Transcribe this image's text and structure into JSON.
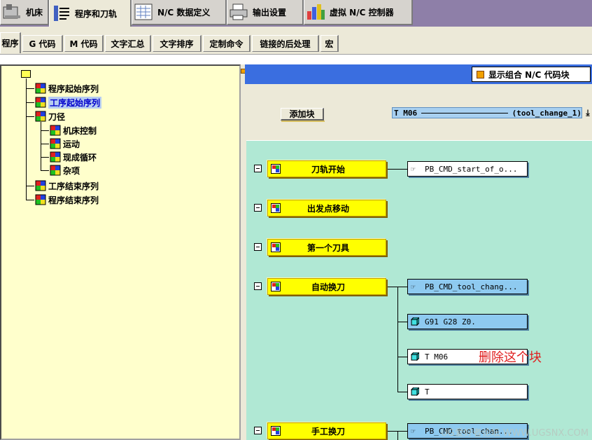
{
  "top_tabs": [
    {
      "label": "机床",
      "icon": "machine-tool-icon",
      "active": false
    },
    {
      "label": "程序和刀轨",
      "icon": "program-toolpath-icon",
      "active": true
    },
    {
      "label": "N/C 数据定义",
      "icon": "nc-data-icon",
      "active": false
    },
    {
      "label": "输出设置",
      "icon": "printer-icon",
      "active": false
    },
    {
      "label": "虚拟 N/C 控制器",
      "icon": "virtual-controller-icon",
      "active": false
    }
  ],
  "sub_tabs": [
    {
      "label": "程序",
      "active": true
    },
    {
      "label": "G 代码",
      "active": false
    },
    {
      "label": "M 代码",
      "active": false
    },
    {
      "label": "文字汇总",
      "active": false
    },
    {
      "label": "文字排序",
      "active": false
    },
    {
      "label": "定制命令",
      "active": false
    },
    {
      "label": "链接的后处理",
      "active": false
    },
    {
      "label": "宏",
      "active": false
    }
  ],
  "tree": {
    "root_icon": "folder-icon",
    "items": [
      {
        "label": "程序起始序列",
        "level": 1,
        "selected": false
      },
      {
        "label": "工序起始序列",
        "level": 1,
        "selected": true
      },
      {
        "label": "刀径",
        "level": 1,
        "selected": false
      },
      {
        "label": "机床控制",
        "level": 2,
        "selected": false
      },
      {
        "label": "运动",
        "level": 2,
        "selected": false
      },
      {
        "label": "现成循环",
        "level": 2,
        "selected": false
      },
      {
        "label": "杂项",
        "level": 2,
        "selected": false
      },
      {
        "label": "工序结束序列",
        "level": 1,
        "selected": false
      },
      {
        "label": "程序结束序列",
        "level": 1,
        "selected": false
      }
    ]
  },
  "right_panel": {
    "show_combined_label": "显示组合 N/C 代码块",
    "add_block_label": "添加块",
    "block_select": {
      "left": "T M06",
      "right": "(tool_change_1)"
    }
  },
  "events": [
    {
      "label": "刀轨开始",
      "blocks": [
        {
          "text": "PB_CMD_start_of_o...",
          "type": "command",
          "highlight": false
        }
      ]
    },
    {
      "label": "出发点移动",
      "blocks": []
    },
    {
      "label": "第一个刀具",
      "blocks": []
    },
    {
      "label": "自动换刀",
      "blocks": [
        {
          "text": "PB_CMD_tool_chang...",
          "type": "command",
          "highlight": true
        },
        {
          "text": "G91 G28 Z0.",
          "type": "block",
          "highlight": true
        },
        {
          "text": "T M06",
          "type": "block",
          "highlight": false
        },
        {
          "text": "T",
          "type": "block",
          "highlight": false
        }
      ]
    },
    {
      "label": "手工换刀",
      "blocks": [
        {
          "text": "PB_CMD_tool_chan...",
          "type": "command",
          "highlight": true
        }
      ]
    }
  ],
  "annotation": "删除这个块",
  "watermark": "UG爱好者论坛 WWW.UGSNX.COM",
  "colors": {
    "top_bar": "#8e7fa8",
    "tree_bg": "#ffffcc",
    "canvas_bg": "#b0e8d4",
    "event_button": "#ffff00",
    "highlight_block": "#8ecaf0",
    "annotation": "#e02020"
  }
}
